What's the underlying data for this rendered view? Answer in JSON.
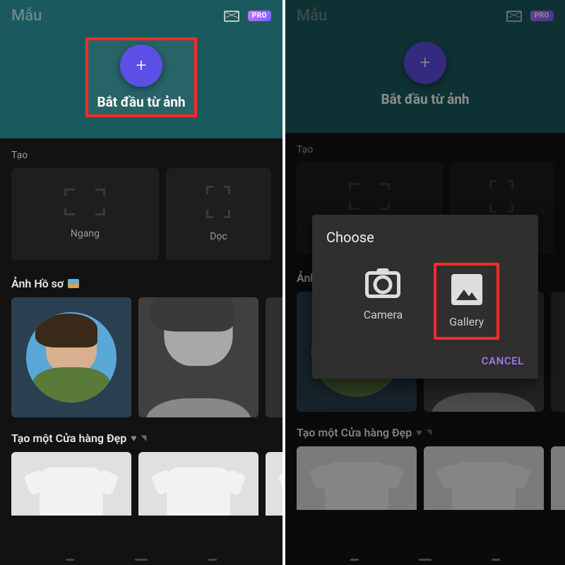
{
  "header": {
    "title": "Mẫu",
    "pro_badge": "PRO"
  },
  "start": {
    "plus": "+",
    "label": "Bắt đầu từ ảnh"
  },
  "create": {
    "section_label": "Tạo",
    "horizontal": "Ngang",
    "vertical": "Dọc"
  },
  "profile": {
    "section_title": "Ảnh Hồ sơ"
  },
  "shop": {
    "section_title": "Tạo một Cửa hàng Đẹp"
  },
  "dialog": {
    "title": "Choose",
    "camera": "Camera",
    "gallery": "Gallery",
    "cancel": "CANCEL"
  }
}
